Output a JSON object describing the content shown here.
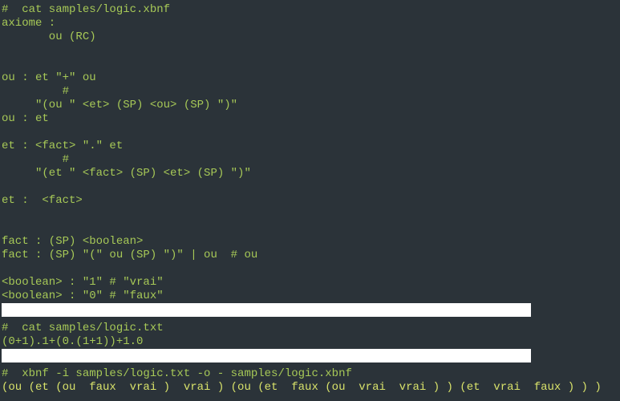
{
  "terminal": {
    "lines": [
      {
        "type": "prompt",
        "text": "#  cat samples/logic.xbnf"
      },
      {
        "type": "output",
        "text": "axiome :"
      },
      {
        "type": "output",
        "text": "       ou (RC)"
      },
      {
        "type": "output",
        "text": ""
      },
      {
        "type": "output",
        "text": ""
      },
      {
        "type": "output",
        "text": "ou : et \"+\" ou"
      },
      {
        "type": "output",
        "text": "         #"
      },
      {
        "type": "output",
        "text": "     \"(ou \" <et> (SP) <ou> (SP) \")\""
      },
      {
        "type": "output",
        "text": "ou : et"
      },
      {
        "type": "output",
        "text": ""
      },
      {
        "type": "output",
        "text": "et : <fact> \".\" et"
      },
      {
        "type": "output",
        "text": "         #"
      },
      {
        "type": "output",
        "text": "     \"(et \" <fact> (SP) <et> (SP) \")\""
      },
      {
        "type": "output",
        "text": ""
      },
      {
        "type": "output",
        "text": "et :  <fact>"
      },
      {
        "type": "output",
        "text": ""
      },
      {
        "type": "output",
        "text": ""
      },
      {
        "type": "output",
        "text": "fact : (SP) <boolean>"
      },
      {
        "type": "output",
        "text": "fact : (SP) \"(\" ou (SP) \")\" | ou  # ou"
      },
      {
        "type": "output",
        "text": ""
      },
      {
        "type": "output",
        "text": "<boolean> : \"1\" # \"vrai\""
      },
      {
        "type": "output",
        "text": "<boolean> : \"0\" # \"faux\""
      },
      {
        "type": "whitebar",
        "text": ""
      },
      {
        "type": "prompt",
        "text": "#  cat samples/logic.txt"
      },
      {
        "type": "output",
        "text": "(0+1).1+(0.(1+1))+1.0"
      },
      {
        "type": "whitebar",
        "text": ""
      },
      {
        "type": "prompt",
        "text": "#  xbnf -i samples/logic.txt -o - samples/logic.xbnf"
      },
      {
        "type": "bright",
        "text": "(ou (et (ou  faux  vrai )  vrai ) (ou (et  faux (ou  vrai  vrai ) ) (et  vrai  faux ) ) )"
      }
    ]
  }
}
